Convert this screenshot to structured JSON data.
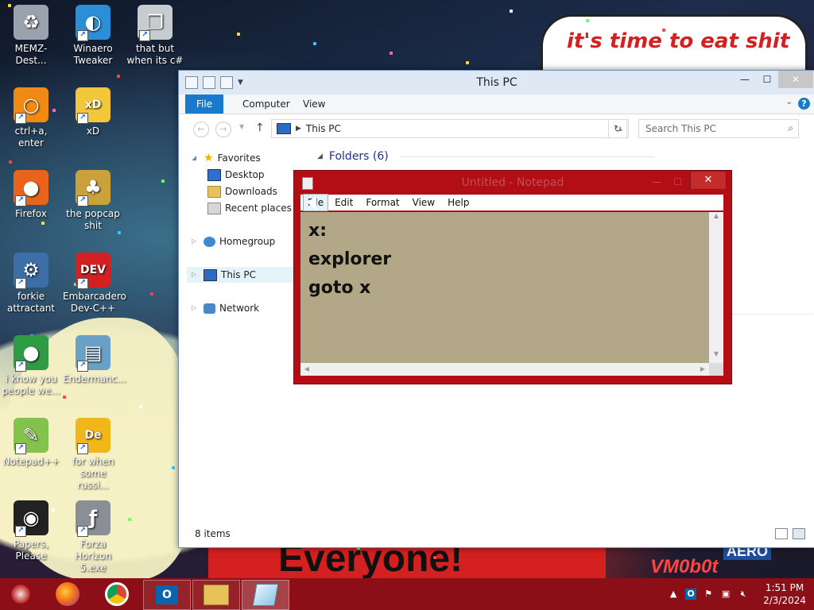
{
  "desktop": {
    "meme_text": "it's time to eat shit",
    "banner_text": "Everyone!",
    "sticker_text": "VM0b0t",
    "corner_text": "AERO",
    "icons": [
      {
        "label": "MEMZ-Dest...",
        "icon": "recycle-bin-icon",
        "color": "#9aa3ad",
        "glyph": "♻"
      },
      {
        "label": "Winaero Tweaker",
        "icon": "winaero-icon",
        "color": "#2b8fd8",
        "glyph": "◐"
      },
      {
        "label": "that but when its c#",
        "icon": "stacked-windows-icon",
        "color": "#c7ccd1",
        "glyph": "❐"
      },
      {
        "label": "ctrl+a, enter",
        "icon": "ring-icon",
        "color": "#f08a12",
        "glyph": "○"
      },
      {
        "label": "xD",
        "icon": "hxd-icon",
        "color": "#f2c83a",
        "glyph": "xD"
      },
      {
        "label": "Firefox",
        "icon": "firefox-icon",
        "color": "#e8641c",
        "glyph": "●"
      },
      {
        "label": "the popcap shit",
        "icon": "popcap-icon",
        "color": "#caa13a",
        "glyph": "♣"
      },
      {
        "label": "forkie attractant",
        "icon": "settings-monitor-icon",
        "color": "#3c6ea8",
        "glyph": "⚙"
      },
      {
        "label": "Embarcadero Dev-C++",
        "icon": "devcpp-icon",
        "color": "#d42020",
        "glyph": "DEV"
      },
      {
        "label": "i know you people we...",
        "icon": "chrome-icon",
        "color": "#2f9b45",
        "glyph": "●"
      },
      {
        "label": "Endermanc...",
        "icon": "endermanch-icon",
        "color": "#6aa0c6",
        "glyph": "▤"
      },
      {
        "label": "Notepad++",
        "icon": "notepadpp-icon",
        "color": "#84c24e",
        "glyph": "✎"
      },
      {
        "label": "for when some russi...",
        "icon": "de-icon",
        "color": "#f0b61a",
        "glyph": "De"
      },
      {
        "label": "Papers, Please",
        "icon": "papers-please-icon",
        "color": "#222222",
        "glyph": "◉"
      },
      {
        "label": "Forza Horizon 5.exe",
        "icon": "flash-icon",
        "color": "#8a8f96",
        "glyph": "ƒ"
      }
    ]
  },
  "explorer": {
    "title": "This PC",
    "tabs": [
      "File",
      "Computer",
      "View"
    ],
    "address": "This PC",
    "search_placeholder": "Search This PC",
    "nav": {
      "favorites": "Favorites",
      "desktop": "Desktop",
      "downloads": "Downloads",
      "recent_places": "Recent places",
      "homegroup": "Homegroup",
      "this_pc": "This PC",
      "network": "Network"
    },
    "folders_header": "Folders (6)",
    "status": "8 items"
  },
  "notepad": {
    "title": "Untitled - Notepad",
    "menus": [
      "File",
      "Edit",
      "Format",
      "View",
      "Help"
    ],
    "content": "x:\nexplorer\ngoto x",
    "editor_bg": "#b2a786",
    "frame_color": "#b30e16"
  },
  "taskbar": {
    "color": "#8c0f17",
    "time": "1:51 PM",
    "date": "2/3/2024"
  }
}
